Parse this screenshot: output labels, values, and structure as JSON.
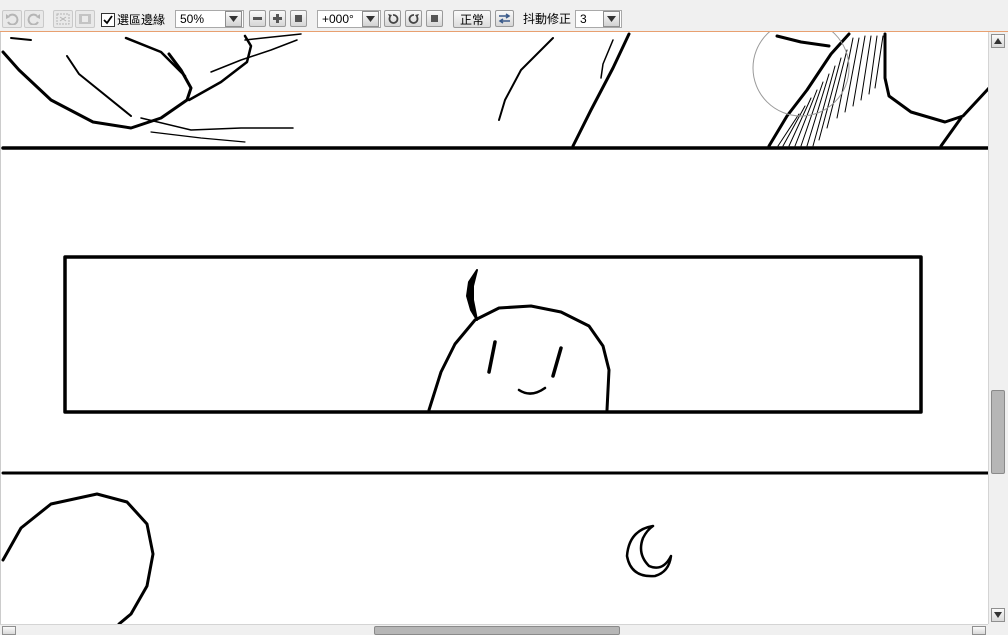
{
  "toolbar": {
    "selection_edge_label": "選區邊緣",
    "selection_edge_checked": true,
    "zoom_value": "50%",
    "rotation_value": "+000°",
    "blend_mode_label": "正常",
    "stabilizer_label": "抖動修正",
    "stabilizer_value": "3",
    "icons": [
      "undo-icon",
      "redo-icon",
      "deselect-icon",
      "invert-selection-icon",
      "zoom-out-icon",
      "zoom-in-icon",
      "zoom-reset-icon",
      "rotate-ccw-icon",
      "rotate-cw-icon",
      "rotate-reset-icon",
      "flip-horizontal-icon"
    ]
  },
  "canvas": {
    "description_free": true
  },
  "scrollbars": {
    "vertical_position": 0.72,
    "horizontal_position": 0.42
  },
  "colors": {
    "toolbar_bg": "#f0f0f0",
    "toolbar_border": "#e8a070",
    "ink": "#000000"
  }
}
